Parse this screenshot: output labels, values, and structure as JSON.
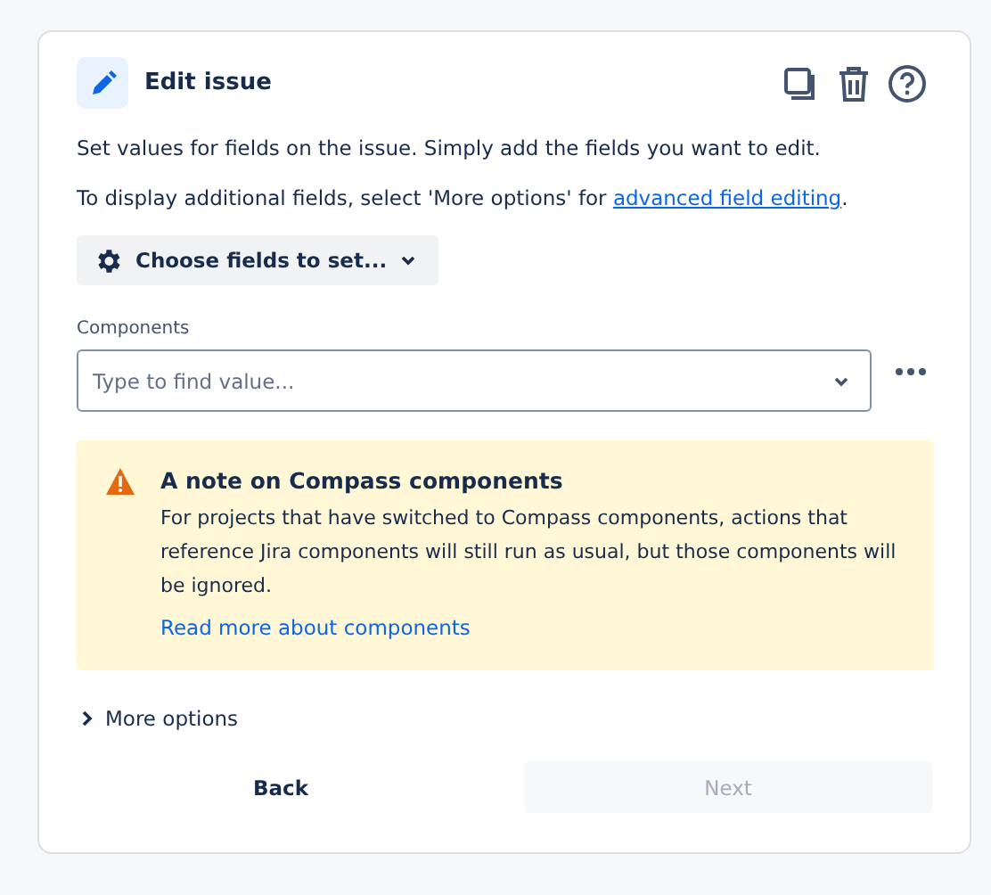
{
  "header": {
    "title": "Edit issue"
  },
  "description": "Set values for fields on the issue. Simply add the fields you want to edit.",
  "advanced": {
    "text": "To display additional fields, select 'More options' for ",
    "link": "advanced field editing",
    "suffix": "."
  },
  "choose_button": {
    "label": "Choose fields to set..."
  },
  "field": {
    "label": "Components",
    "placeholder": "Type to find value..."
  },
  "warning": {
    "title": "A note on Compass components",
    "body": "For projects that have switched to Compass components, actions that reference Jira components will still run as usual, but those components will be ignored.",
    "link": "Read more about components"
  },
  "more_options": {
    "label": "More options",
    "expanded": false
  },
  "buttons": [
    {
      "label": "Back",
      "disabled": false,
      "kind": "subtle"
    },
    {
      "label": "Next",
      "disabled": true,
      "kind": "primary"
    }
  ]
}
